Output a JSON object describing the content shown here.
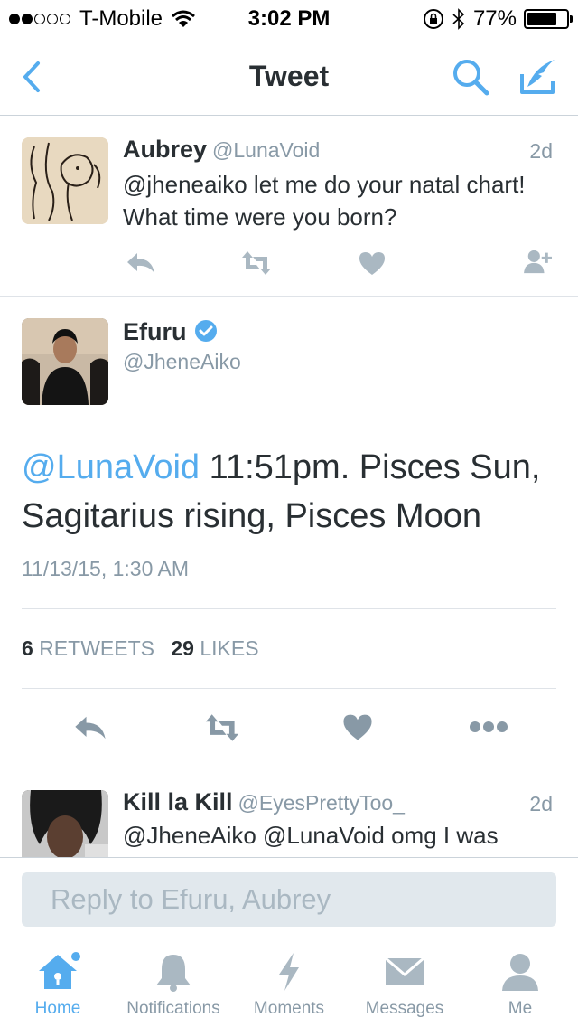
{
  "status_bar": {
    "carrier": "T-Mobile",
    "time": "3:02 PM",
    "battery": "77%",
    "battery_level": 0.77,
    "signal_bars": 2
  },
  "nav": {
    "title": "Tweet"
  },
  "colors": {
    "accent": "#55acee",
    "muted": "#8899a6",
    "text": "#292f33",
    "icon_gray": "#aab8c2"
  },
  "tweets": [
    {
      "name": "Aubrey",
      "handle": "@LunaVoid",
      "age": "2d",
      "line1": "@jheneaiko let me do your natal chart!",
      "line2": "What time were you born?"
    },
    {
      "name": "Efuru",
      "handle": "@JheneAiko",
      "verified": true,
      "mention": "@LunaVoid",
      "text_line1_rest": " 11:51pm. Pisces Sun,",
      "text_line2": "Sagitarius rising, Pisces Moon",
      "timestamp": "11/13/15, 1:30 AM",
      "retweets": "6",
      "retweets_label": "RETWEETS",
      "likes": "29",
      "likes_label": "LIKES"
    },
    {
      "name": "Kill la Kill",
      "handle": "@EyesPrettyToo_",
      "age": "2d",
      "line1": "@JheneAiko @LunaVoid omg I was"
    }
  ],
  "reply": {
    "placeholder": "Reply to Efuru, Aubrey"
  },
  "tabs": [
    {
      "label": "Home",
      "icon": "home-icon",
      "active": true
    },
    {
      "label": "Notifications",
      "icon": "bell-icon"
    },
    {
      "label": "Moments",
      "icon": "lightning-icon"
    },
    {
      "label": "Messages",
      "icon": "envelope-icon"
    },
    {
      "label": "Me",
      "icon": "person-icon"
    }
  ]
}
